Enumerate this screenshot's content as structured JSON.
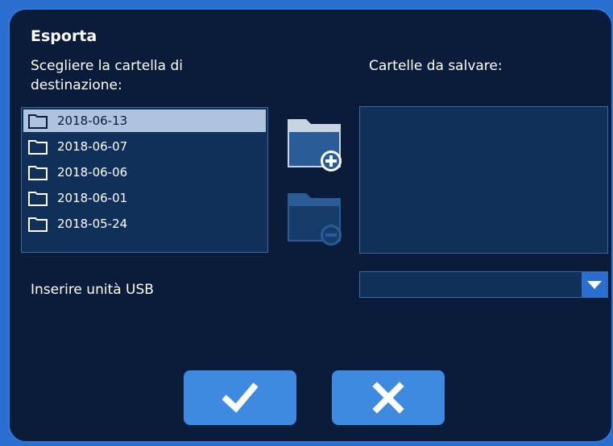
{
  "dialog": {
    "title": "Esporta",
    "dest_label_line1": "Scegliere la cartella di",
    "dest_label_line2": "destinazione:",
    "save_label": "Cartelle da salvare:",
    "usb_label": "Inserire unità USB"
  },
  "folders": [
    {
      "name": "2018-06-13",
      "selected": true
    },
    {
      "name": "2018-06-07",
      "selected": false
    },
    {
      "name": "2018-06-06",
      "selected": false
    },
    {
      "name": "2018-06-01",
      "selected": false
    },
    {
      "name": "2018-05-24",
      "selected": false
    }
  ],
  "icons": {
    "add": "folder-add-icon",
    "remove": "folder-remove-icon",
    "confirm": "checkmark-icon",
    "cancel": "close-icon",
    "dropdown": "triangle-down-icon"
  },
  "colors": {
    "background": "#0b1c3a",
    "accent": "#3d8ae0",
    "selection": "#aec4de",
    "list_bg": "#10305a"
  }
}
